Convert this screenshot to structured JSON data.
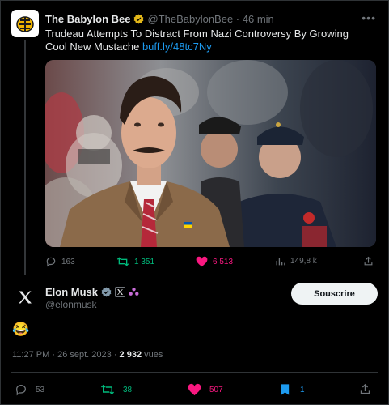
{
  "quoted": {
    "name": "The Babylon Bee",
    "handle": "@TheBabylonBee",
    "time": "46 min",
    "text": "Trudeau Attempts To Distract From Nazi Controversy By Growing Cool New Mustache",
    "link": "buff.ly/48tc7Ny",
    "replies": "163",
    "reposts": "1 351",
    "likes": "6 513",
    "views": "149,8 k"
  },
  "main": {
    "name": "Elon Musk",
    "handle": "@elonmusk",
    "follow_label": "Souscrire",
    "body": "😂",
    "time": "11:27 PM",
    "date": "26 sept. 2023",
    "views": "2 932",
    "views_label": "vues",
    "replies": "53",
    "reposts": "38",
    "likes": "507",
    "bookmarks": "1"
  },
  "colors": {
    "accent": "#1d9bf0",
    "repost": "#00ba7c",
    "like": "#f91880",
    "muted": "#71767b",
    "gold": "#e2b719",
    "grey_badge": "#829aab"
  },
  "icons": [
    "more-icon",
    "verified-gold-icon",
    "reply-icon",
    "repost-icon",
    "like-icon",
    "views-icon",
    "share-icon",
    "verified-icon",
    "x-logo-icon",
    "bookmark-icon"
  ]
}
